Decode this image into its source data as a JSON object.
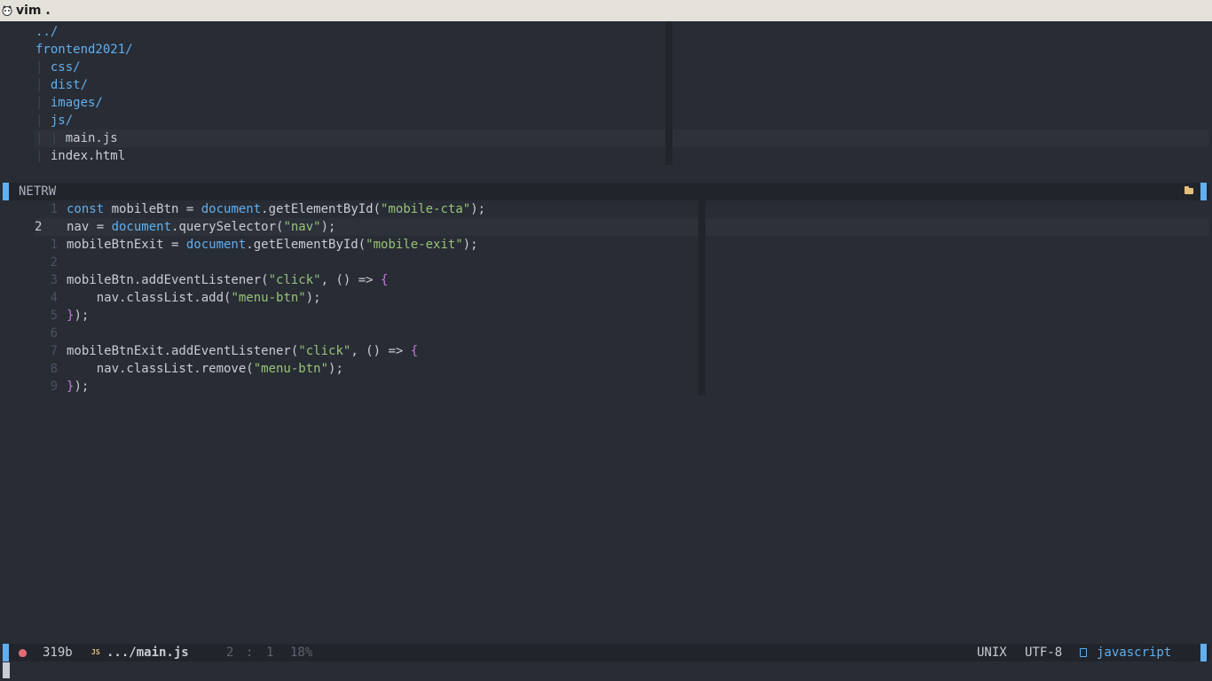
{
  "window": {
    "title": "vim ."
  },
  "netrw": {
    "entries": [
      {
        "prefix": "",
        "name": "../",
        "kind": "dir"
      },
      {
        "prefix": "",
        "name": "frontend2021/",
        "kind": "dir"
      },
      {
        "prefix": "| ",
        "name": "css/",
        "kind": "dir"
      },
      {
        "prefix": "| ",
        "name": "dist/",
        "kind": "dir"
      },
      {
        "prefix": "| ",
        "name": "images/",
        "kind": "dir"
      },
      {
        "prefix": "| ",
        "name": "js/",
        "kind": "dir"
      },
      {
        "prefix": "| | ",
        "name": "main.js",
        "kind": "file"
      },
      {
        "prefix": "| ",
        "name": "index.html",
        "kind": "file"
      }
    ],
    "status_label": "NETRW"
  },
  "editor": {
    "line_numbers": [
      "1",
      "2",
      "1",
      "2",
      "3",
      "4",
      "5",
      "6",
      "7",
      "8",
      "9"
    ],
    "lines": [
      [
        [
          "kw",
          "const"
        ],
        [
          "fn",
          " mobileBtn = "
        ],
        [
          "kw",
          "document"
        ],
        [
          "fn",
          ".getElementById("
        ],
        [
          "str",
          "\"mobile-cta\""
        ],
        [
          "fn",
          ");"
        ]
      ],
      [
        [
          "fn",
          "nav = "
        ],
        [
          "kw",
          "document"
        ],
        [
          "fn",
          ".querySelector("
        ],
        [
          "str",
          "\"nav\""
        ],
        [
          "fn",
          ");"
        ]
      ],
      [
        [
          "fn",
          "mobileBtnExit = "
        ],
        [
          "kw",
          "document"
        ],
        [
          "fn",
          ".getElementById("
        ],
        [
          "str",
          "\"mobile-exit\""
        ],
        [
          "fn",
          ");"
        ]
      ],
      [],
      [
        [
          "fn",
          "mobileBtn.addEventListener("
        ],
        [
          "str",
          "\"click\""
        ],
        [
          "fn",
          ", () => "
        ],
        [
          "brace",
          "{"
        ]
      ],
      [
        [
          "fn",
          "    nav.classList.add("
        ],
        [
          "str",
          "\"menu-btn\""
        ],
        [
          "fn",
          ");"
        ]
      ],
      [
        [
          "brace",
          "}"
        ],
        [
          "fn",
          ");"
        ]
      ],
      [],
      [
        [
          "fn",
          "mobileBtnExit.addEventListener("
        ],
        [
          "str",
          "\"click\""
        ],
        [
          "fn",
          ", () => "
        ],
        [
          "brace",
          "{"
        ]
      ],
      [
        [
          "fn",
          "    nav.classList.remove("
        ],
        [
          "str",
          "\"menu-btn\""
        ],
        [
          "fn",
          ");"
        ]
      ],
      [
        [
          "brace",
          "}"
        ],
        [
          "fn",
          ");"
        ]
      ]
    ]
  },
  "statusline": {
    "filesize": "319b",
    "filetype_badge": "JS",
    "filepath": ".../main.js",
    "line": "2",
    "sep": ":",
    "col": "1",
    "percent": "18%",
    "fileformat": "UNIX",
    "encoding": "UTF-8",
    "filetype": "javascript"
  },
  "colors": {
    "background": "#282c34",
    "accent": "#61afef",
    "string": "#98c379",
    "brace": "#c678dd",
    "folder": "#e5c07b",
    "error": "#e06c75"
  }
}
